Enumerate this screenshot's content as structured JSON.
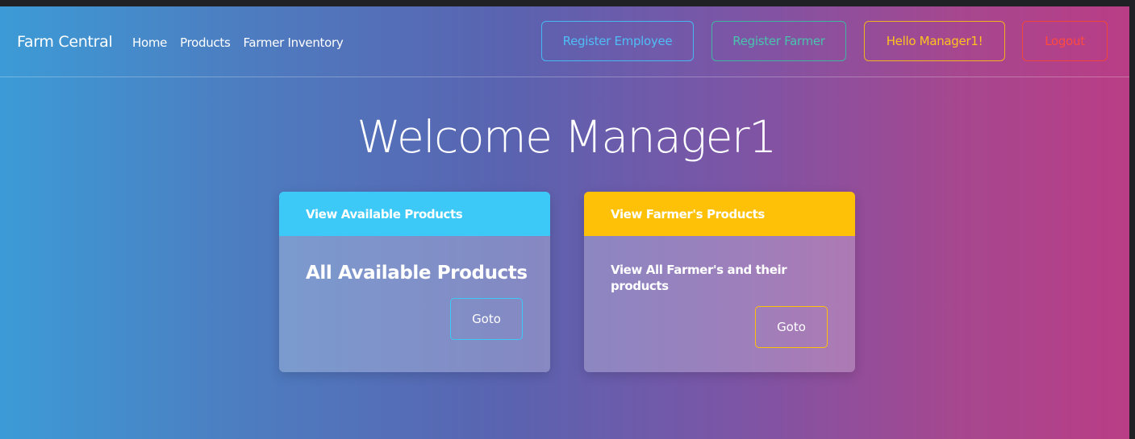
{
  "navbar": {
    "brand": "Farm Central",
    "links": [
      "Home",
      "Products",
      "Farmer Inventory"
    ],
    "buttons": {
      "register_employee": "Register Employee",
      "register_farmer": "Register Farmer",
      "hello": "Hello Manager1!",
      "logout": "Logout"
    }
  },
  "hero": {
    "welcome": "Welcome Manager1"
  },
  "cards": [
    {
      "header": "View Available Products",
      "title": "All Available Products",
      "button": "Goto"
    },
    {
      "header": "View Farmer's Products",
      "text": "View All Farmer's and their products",
      "button": "Goto"
    }
  ],
  "colors": {
    "card1_header": "#3cc9f7",
    "card2_header": "#ffc107",
    "register_employee": "#4fbdf6",
    "register_farmer": "#48c3ae",
    "hello": "#ffc21f",
    "logout": "#ff4a3f"
  }
}
